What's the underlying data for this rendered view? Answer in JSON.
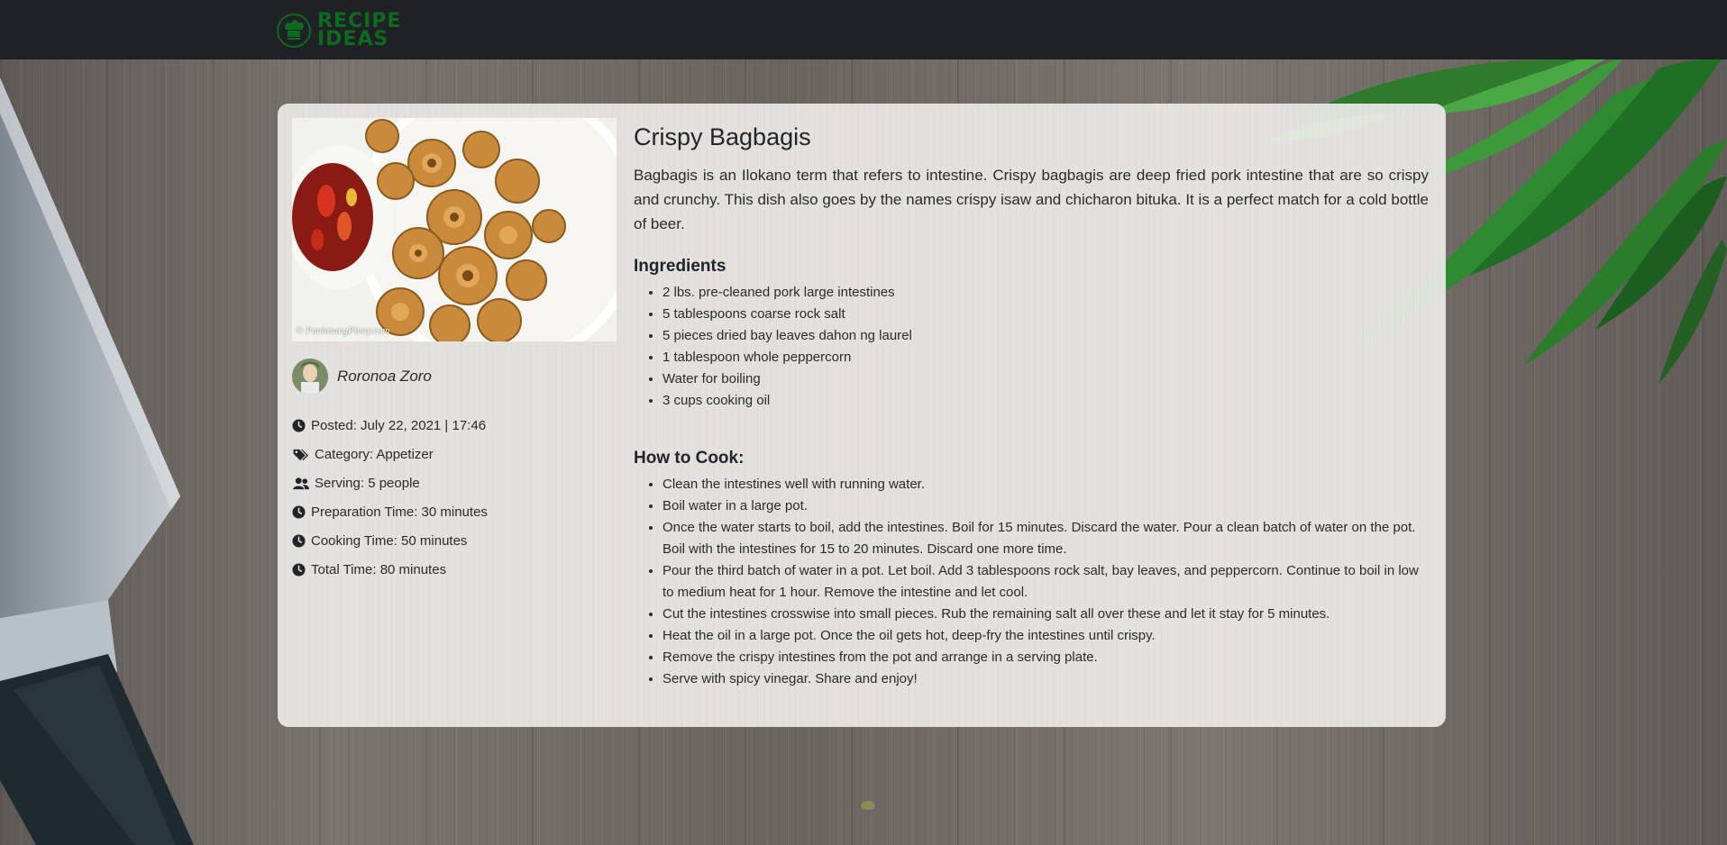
{
  "brand": {
    "line1": "RECIPE",
    "line2": "IDEAS",
    "color": "#0d6b1f",
    "icon": "chef-hat-icon"
  },
  "colors": {
    "navbar": "#1f2125",
    "card": "#eceae7"
  },
  "recipe": {
    "title": "Crispy Bagbagis",
    "description": "Bagbagis is an Ilokano term that refers to intestine. Crispy bagbagis are deep fried pork intestine that are so crispy and crunchy. This dish also goes by the names crispy isaw and chicharon bituka. It is a perfect match for a cold bottle of beer.",
    "image_caption": "© PanlasangPinoy.com",
    "author": "Roronoa Zoro",
    "meta": {
      "posted": "Posted: July 22, 2021 | 17:46",
      "category": "Category: Appetizer",
      "serving": "Serving: 5 people",
      "prep_time": "Preparation Time: 30 minutes",
      "cook_time": "Cooking Time: 50 minutes",
      "total_time": "Total Time: 80 minutes"
    },
    "ingredients_heading": "Ingredients",
    "ingredients": [
      "2 lbs. pre-cleaned pork large intestines",
      "5 tablespoons coarse rock salt",
      "5 pieces dried bay leaves dahon ng laurel",
      "1 tablespoon whole peppercorn",
      "Water for boiling",
      "3 cups cooking oil"
    ],
    "cook_heading": "How to Cook:",
    "steps": [
      "Clean the intestines well with running water.",
      "Boil water in a large pot.",
      "Once the water starts to boil, add the intestines. Boil for 15 minutes. Discard the water. Pour a clean batch of water on the pot. Boil with the intestines for 15 to 20 minutes. Discard one more time.",
      "Pour the third batch of water in a pot. Let boil. Add 3 tablespoons rock salt, bay leaves, and peppercorn. Continue to boil in low to medium heat for 1 hour. Remove the intestine and let cool.",
      "Cut the intestines crosswise into small pieces. Rub the remaining salt all over these and let it stay for 5 minutes.",
      "Heat the oil in a large pot. Once the oil gets hot, deep-fry the intestines until crispy.",
      "Remove the crispy intestines from the pot and arrange in a serving plate.",
      "Serve with spicy vinegar. Share and enjoy!"
    ]
  }
}
